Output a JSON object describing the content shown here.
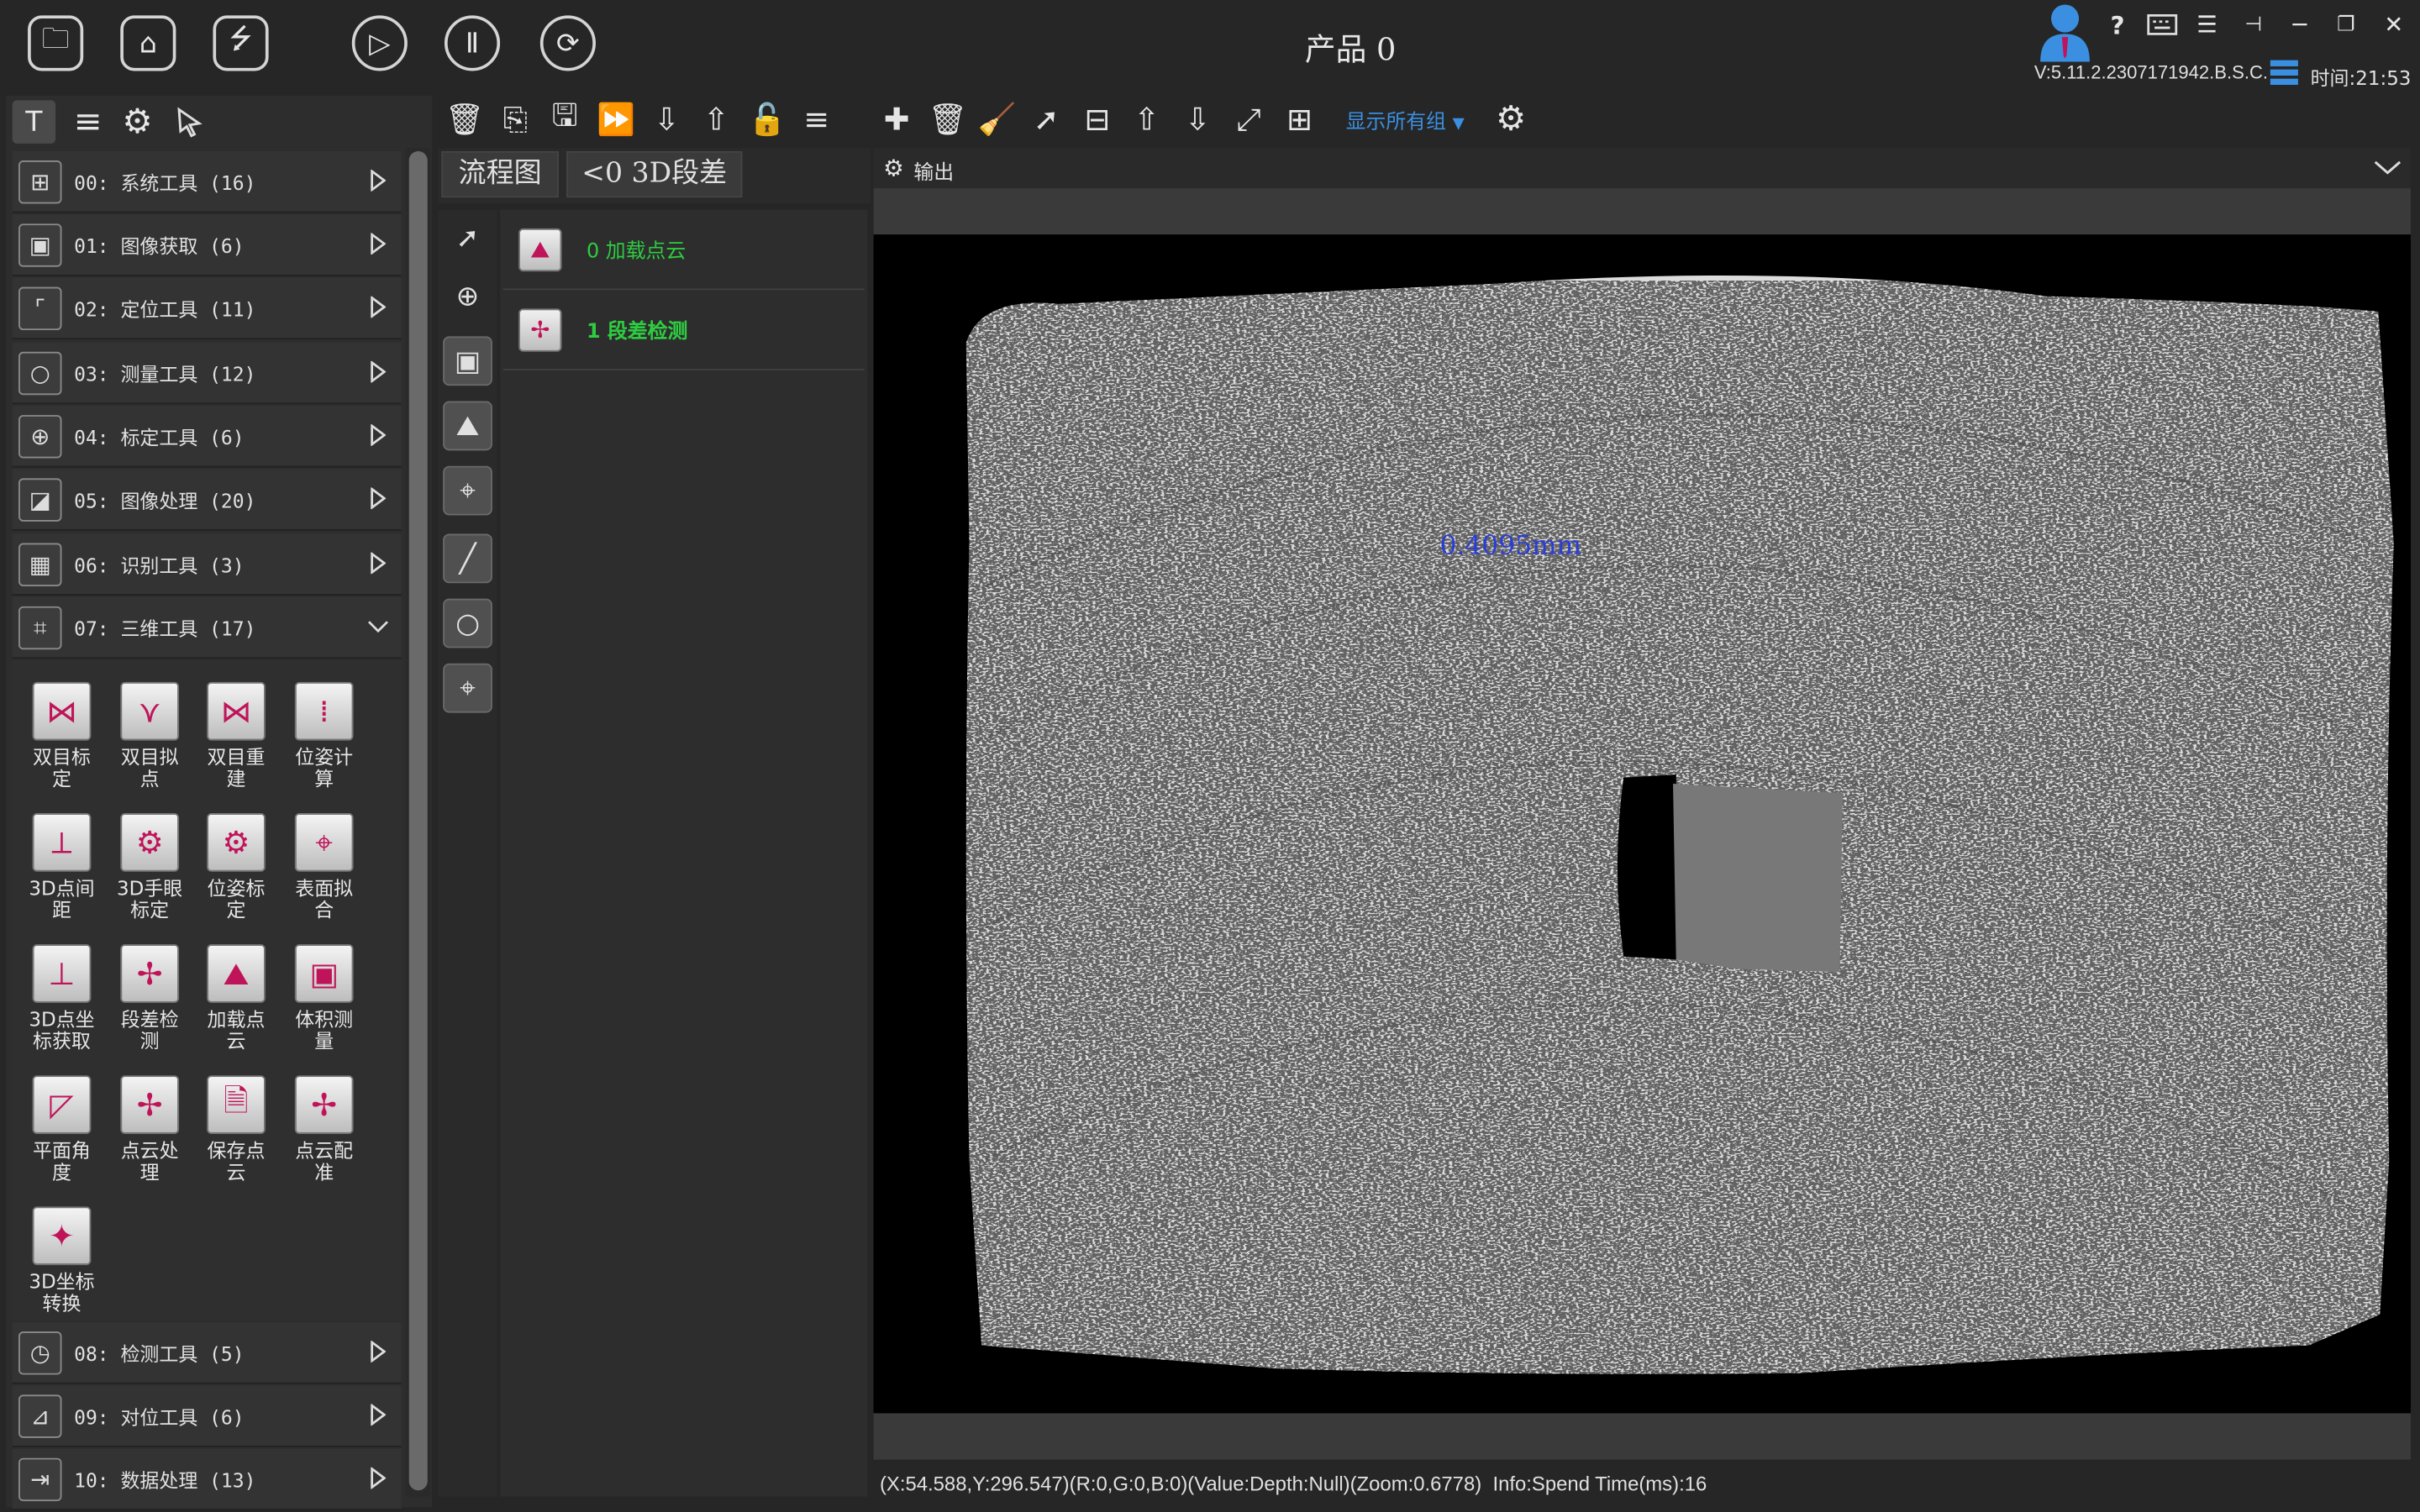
{
  "window": {
    "title": "产品 0",
    "version": "V:5.11.2.2307171942.B.S.C.",
    "time": "时间:21:53"
  },
  "toolbar_icons": [
    "folder-icon",
    "home-icon",
    "usb-icon",
    "play-icon",
    "pause-icon",
    "loop-icon"
  ],
  "left_tabs": [
    "hammer-icon",
    "list-icon",
    "gear-icon",
    "cursor-icon"
  ],
  "categories": [
    {
      "label": "00: 系统工具 (16)",
      "icon": "network-icon"
    },
    {
      "label": "01: 图像获取 (6)",
      "icon": "image-acquire-icon"
    },
    {
      "label": "02: 定位工具 (11)",
      "icon": "locate-icon"
    },
    {
      "label": "03: 测量工具 (12)",
      "icon": "measure-circle-icon"
    },
    {
      "label": "04: 标定工具 (6)",
      "icon": "calibration-grid-icon"
    },
    {
      "label": "05: 图像处理 (20)",
      "icon": "image-process-icon"
    },
    {
      "label": "06: 识别工具 (3)",
      "icon": "qr-code-icon"
    },
    {
      "label": "07: 三维工具 (17)",
      "icon": "3d-tool-icon"
    },
    {
      "label": "08: 检测工具 (5)",
      "icon": "clock-icon"
    },
    {
      "label": "09: 对位工具 (6)",
      "icon": "align-icon"
    },
    {
      "label": "10: 数据处理 (13)",
      "icon": "data-process-icon"
    }
  ],
  "tools3d": [
    {
      "label": "双目标定",
      "icon": "stereo-calib-icon"
    },
    {
      "label": "双目拟点",
      "icon": "stereo-fit-icon"
    },
    {
      "label": "双目重建",
      "icon": "stereo-rebuild-icon"
    },
    {
      "label": "位姿计算",
      "icon": "pose-calc-icon"
    },
    {
      "label": "3D点间距",
      "icon": "3d-distance-icon"
    },
    {
      "label": "3D手眼标定",
      "icon": "hand-eye-icon"
    },
    {
      "label": "位姿标定",
      "icon": "pose-calib-icon"
    },
    {
      "label": "表面拟合",
      "icon": "surface-fit-icon"
    },
    {
      "label": "3D点坐标获取",
      "icon": "3d-point-icon"
    },
    {
      "label": "段差检测",
      "icon": "step-detect-icon"
    },
    {
      "label": "加载点云",
      "icon": "load-cloud-icon"
    },
    {
      "label": "体积测量",
      "icon": "volume-icon"
    },
    {
      "label": "平面角度",
      "icon": "plane-angle-icon"
    },
    {
      "label": "点云处理",
      "icon": "cloud-process-icon"
    },
    {
      "label": "保存点云",
      "icon": "save-cloud-icon"
    },
    {
      "label": "点云配准",
      "icon": "cloud-register-icon"
    },
    {
      "label": "3D坐标转换",
      "icon": "coord-transform-icon"
    }
  ],
  "flow": {
    "tabs": [
      "流程图",
      "<0 3D段差"
    ],
    "toolbar_icons": [
      "delete-icon",
      "copy-icon",
      "save-icon",
      "forward-icon",
      "arrow-down-icon",
      "arrow-up-icon",
      "unlock-icon",
      "menu-icon"
    ],
    "side_tools": [
      "cursor-icon",
      "add-circle-icon",
      "image-icon",
      "landscape-icon",
      "target-icon",
      "line-icon",
      "circle-icon",
      "crosshair-icon"
    ],
    "nodes": [
      {
        "label": "0 加载点云",
        "icon": "load-cloud-icon"
      },
      {
        "label": "1 段差检测",
        "icon": "step-detect-icon"
      }
    ]
  },
  "output": {
    "toolbar_icons": [
      "plus-icon",
      "trash-icon",
      "broom-icon",
      "select-icon",
      "window-icon",
      "arrow-up-icon",
      "arrow-down-icon",
      "resize-icon",
      "grid-icon"
    ],
    "group_select": "显示所有组",
    "title": "输出",
    "measurement": "0.4095mm",
    "status": "(X:54.588,Y:296.547)(R:0,G:0,B:0)(Value:Depth:Null)(Zoom:0.6778)  Info:Spend Time(ms):16"
  }
}
